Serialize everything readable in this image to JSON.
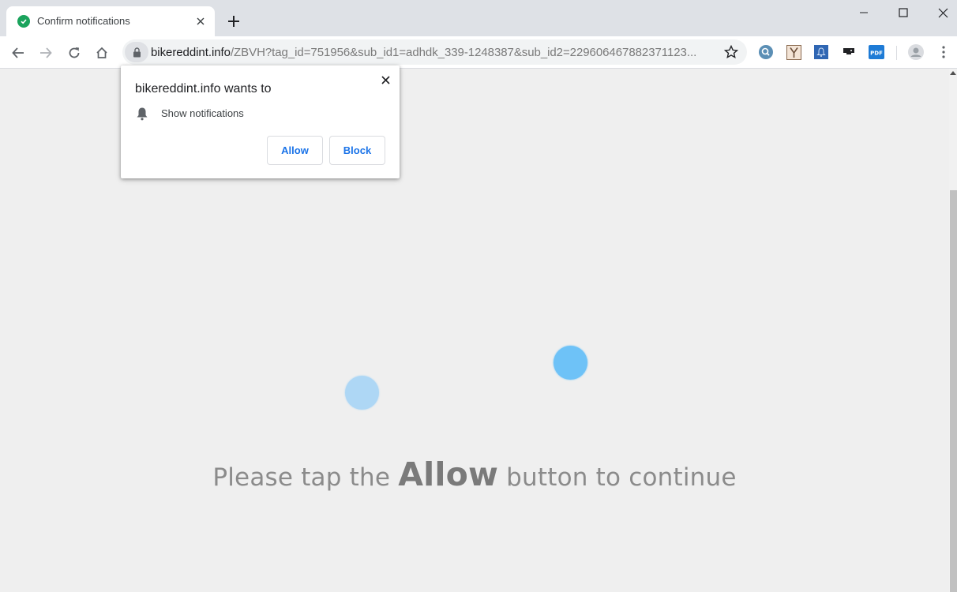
{
  "tab": {
    "title": "Confirm notifications",
    "favicon": "check-circle-icon"
  },
  "address_bar": {
    "host": "bikereddint.info",
    "path": "/ZBVH?tag_id=751956&sub_id1=adhdk_339-1248387&sub_id2=229606467882371123..."
  },
  "popup": {
    "title": "bikereddint.info wants to",
    "permission": "Show notifications",
    "allow_label": "Allow",
    "block_label": "Block"
  },
  "page": {
    "message_pre": "Please tap the ",
    "message_strong": "Allow",
    "message_post": " button to continue"
  },
  "extensions": [
    "search-extension-icon",
    "y-extension-icon",
    "bell-extension-icon",
    "cast-extension-icon",
    "pdf-extension-icon"
  ],
  "colors": {
    "accent": "#1a73e8",
    "dot_left": "#aed7f5",
    "dot_right": "#6ec2f7",
    "favicon": "#1aa35c"
  }
}
